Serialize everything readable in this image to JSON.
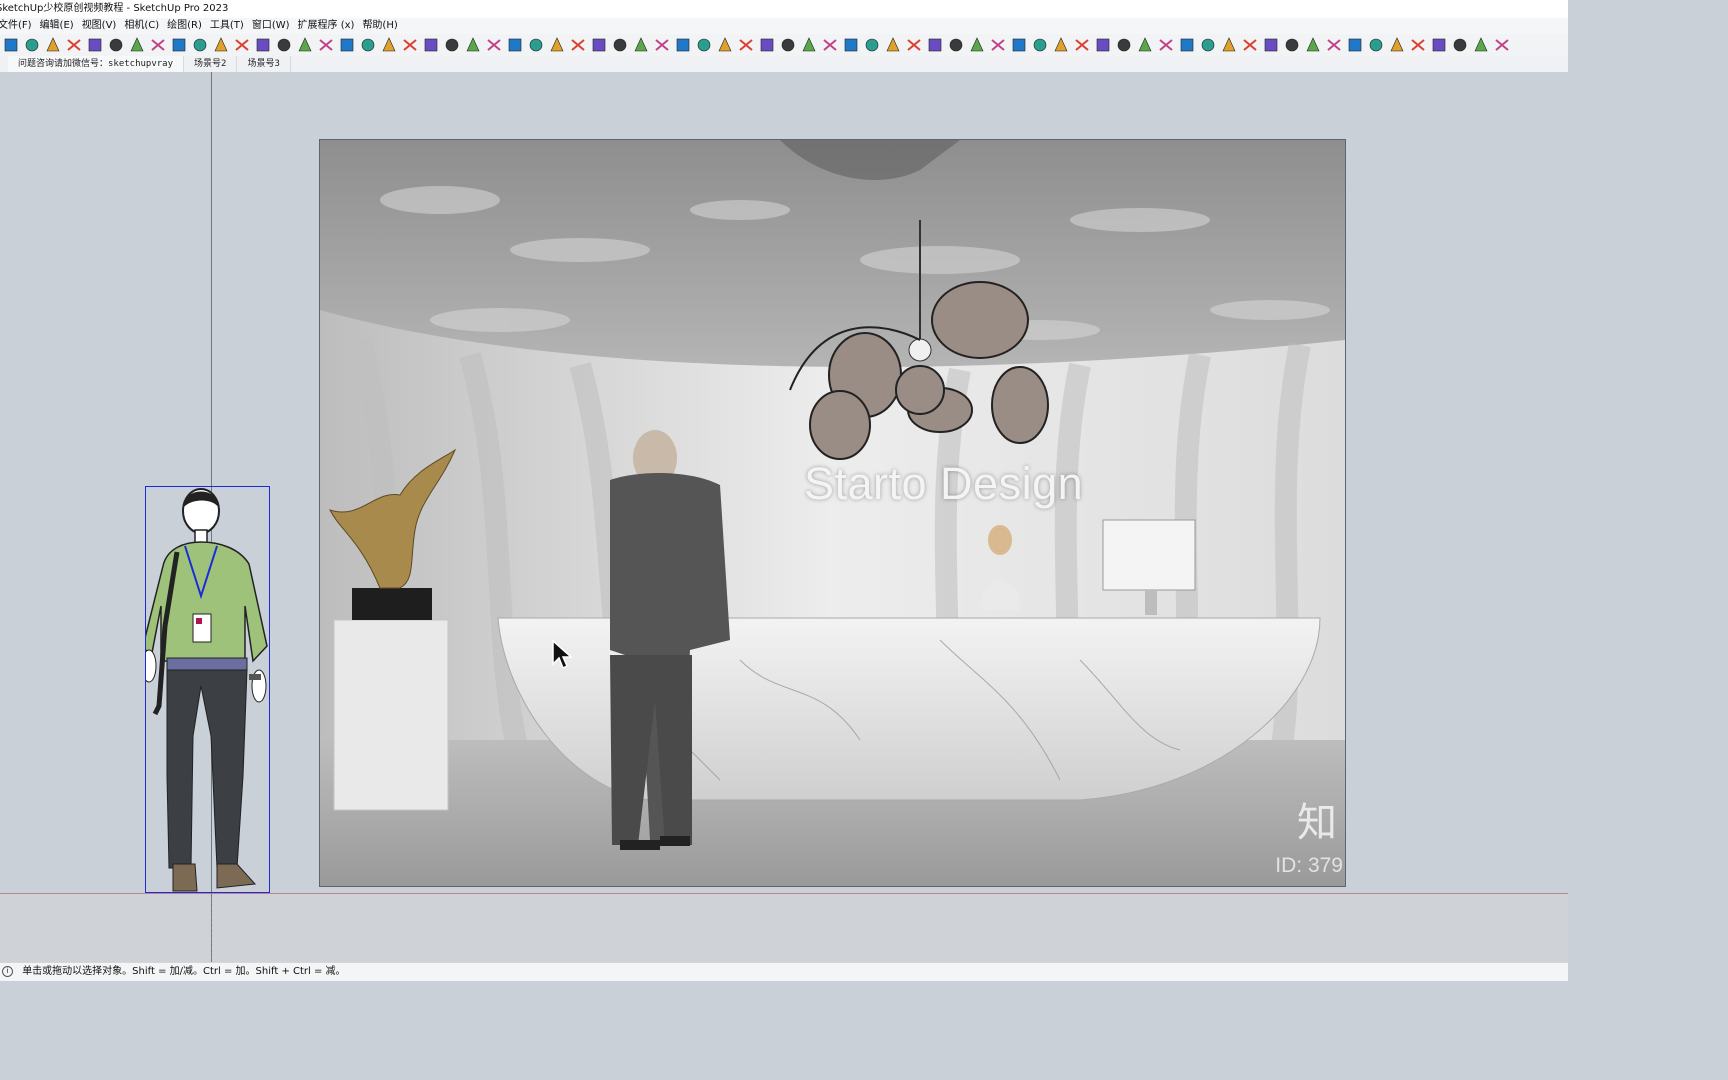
{
  "window": {
    "title": "SketchUp少校原创视频教程 - SketchUp Pro 2023"
  },
  "menu": {
    "items": [
      "文件(F)",
      "编辑(E)",
      "视图(V)",
      "相机(C)",
      "绘图(R)",
      "工具(T)",
      "窗口(W)",
      "扩展程序 (x)",
      "帮助(H)"
    ]
  },
  "toolbar": {
    "icon_count": 72
  },
  "scenes": {
    "tabs": [
      "问题咨询请加微信号：sketchupvray",
      "场景号2",
      "场景号3"
    ]
  },
  "viewport": {
    "image": {
      "brand_text": "Starto Design",
      "watermark_char": "知",
      "watermark_id": "ID: 379"
    }
  },
  "status": {
    "text": "单击或拖动以选择对象。Shift = 加/减。Ctrl = 加。Shift + Ctrl = 减。"
  },
  "colors": {
    "selection": "#1c2ad8",
    "shirt": "#9fc27b",
    "pants": "#3c3f44",
    "viewport_bg": "#c9d0d8"
  }
}
